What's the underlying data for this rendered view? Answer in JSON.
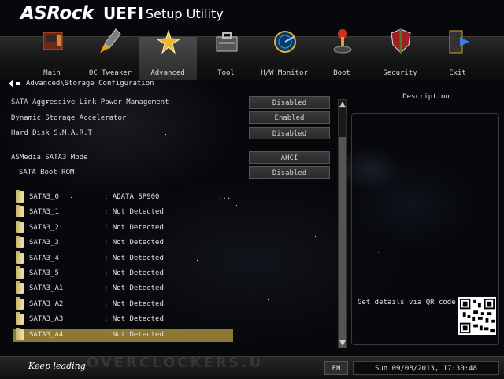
{
  "header": {
    "brand": "ASRock",
    "product": "UEFI",
    "subtitle": "Setup Utility"
  },
  "menu": {
    "active": "Advanced",
    "tabs": [
      {
        "label": "Main",
        "icon": "main-board-icon"
      },
      {
        "label": "OC Tweaker",
        "icon": "rocket-icon"
      },
      {
        "label": "Advanced",
        "icon": "star-burst-icon"
      },
      {
        "label": "Tool",
        "icon": "toolbox-icon"
      },
      {
        "label": "H/W Monitor",
        "icon": "radar-icon"
      },
      {
        "label": "Boot",
        "icon": "joystick-icon"
      },
      {
        "label": "Security",
        "icon": "shield-icon"
      },
      {
        "label": "Exit",
        "icon": "exit-door-icon"
      }
    ]
  },
  "breadcrumb": "Advanced\\Storage Configuration",
  "settings": [
    {
      "label": "SATA Aggressive Link Power Management",
      "value": "Disabled"
    },
    {
      "label": "Dynamic Storage Accelerator",
      "value": "Enabled"
    },
    {
      "label": "Hard Disk S.M.A.R.T",
      "value": "Disabled"
    },
    {
      "label": "ASMedia SATA3 Mode",
      "value": "AHCI"
    },
    {
      "label": "SATA Boot ROM",
      "value": "Disabled"
    }
  ],
  "ellipsis": "...",
  "drives": [
    {
      "name": "SATA3_0",
      "status": ": ADATA SP900"
    },
    {
      "name": "SATA3_1",
      "status": ": Not Detected"
    },
    {
      "name": "SATA3_2",
      "status": ": Not Detected"
    },
    {
      "name": "SATA3_3",
      "status": ": Not Detected"
    },
    {
      "name": "SATA3_4",
      "status": ": Not Detected"
    },
    {
      "name": "SATA3_5",
      "status": ": Not Detected"
    },
    {
      "name": "SATA3_A1",
      "status": ": Not Detected"
    },
    {
      "name": "SATA3_A2",
      "status": ": Not Detected"
    },
    {
      "name": "SATA3_A3",
      "status": ": Not Detected"
    },
    {
      "name": "SATA3_A4",
      "status": ": Not Detected"
    }
  ],
  "selected_drive": "SATA3_A4",
  "description": {
    "title": "Description",
    "qr_text": "Get details via QR code"
  },
  "footer": {
    "slogan": "Keep leading",
    "watermark": "OVERCLOCKERS.U",
    "language": "EN",
    "datetime": "Sun 09/08/2013, 17:30:48"
  },
  "colors": {
    "selection": "#8c7a34",
    "menu_active": "#4a4a4a"
  }
}
